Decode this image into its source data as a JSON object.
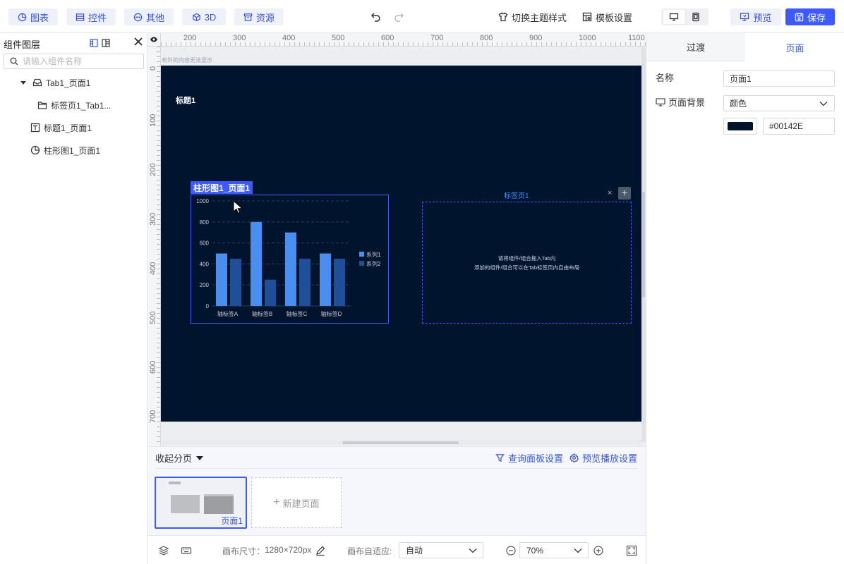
{
  "toolbar": {
    "chart_label": "图表",
    "control_label": "控件",
    "other_label": "其他",
    "three_d_label": "3D",
    "resource_label": "资源",
    "theme_label": "切换主题样式",
    "template_label": "模板设置",
    "preview_label": "预览",
    "save_label": "保存"
  },
  "layers": {
    "title": "组件图层",
    "search_placeholder": "请输入组件名称",
    "items": [
      {
        "label": "Tab1_页面1"
      },
      {
        "label": "标签页1_Tab1..."
      },
      {
        "label": "标题1_页面1"
      },
      {
        "label": "柱形图1_页面1"
      }
    ]
  },
  "canvas": {
    "ruler_x": [
      "200",
      "300",
      "400",
      "500",
      "600",
      "700",
      "800",
      "900",
      "1000",
      "1100"
    ],
    "ruler_y": [
      "0",
      "100",
      "200",
      "300",
      "400",
      "500",
      "600",
      "700"
    ],
    "outside_hint": "布外的内容无法显示",
    "background": "#00142E",
    "title_component": "标题1",
    "chart_tag": "柱形图1_页面1",
    "tab": {
      "title": "标签页1",
      "close": "×",
      "add": "+",
      "hint_line1": "请将组件/组合拖入Tab内",
      "hint_line2": "添加的组件/组合可以在Tab标签页内自由布局"
    }
  },
  "chart_data": {
    "type": "bar",
    "categories": [
      "轴标签A",
      "轴标签B",
      "轴标签C",
      "轴标签D"
    ],
    "series": [
      {
        "name": "系列1",
        "values": [
          500,
          800,
          700,
          500
        ],
        "color": "#4a8ef0"
      },
      {
        "name": "系列2",
        "values": [
          450,
          250,
          450,
          450
        ],
        "color": "#1f4f99"
      }
    ],
    "y_ticks": [
      "0",
      "200",
      "400",
      "600",
      "800",
      "1000"
    ],
    "ylim": [
      0,
      1000
    ],
    "grid": true,
    "legend_position": "right"
  },
  "pages": {
    "collapse_label": "收起分页",
    "query_panel_label": "查询面板设置",
    "preview_play_label": "预览播放设置",
    "page_label": "页面1",
    "new_page_label": "新建页面"
  },
  "footer": {
    "canvas_size_label": "画布尺寸：",
    "canvas_size_value": "1280×720px",
    "adapt_label": "画布自适应:",
    "adapt_value": "自动",
    "zoom_value": "70%"
  },
  "properties": {
    "tab_transition": "过渡",
    "tab_page": "页面",
    "name_label": "名称",
    "name_value": "页面1",
    "bg_label": "页面背景",
    "bg_type_value": "颜色",
    "color_value": "#00142E"
  }
}
